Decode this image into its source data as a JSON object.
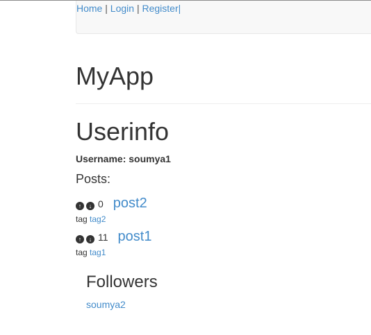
{
  "nav": {
    "home": "Home",
    "sep1": "|",
    "login": "Login",
    "sep2": "|",
    "register": "Register|"
  },
  "brand": "MyApp",
  "page_title": "Userinfo",
  "username_line": "Username: soumya1",
  "posts_heading": "Posts:",
  "posts": [
    {
      "score": "0",
      "title": "post2",
      "tag_label": "tag",
      "tag": "tag2"
    },
    {
      "score": "11",
      "title": "post1",
      "tag_label": "tag",
      "tag": "tag1"
    }
  ],
  "followers": {
    "heading": "Followers",
    "items": [
      "soumya2"
    ]
  },
  "icons": {
    "upvote": "circle-arrow-up-icon",
    "downvote": "circle-arrow-down-icon"
  },
  "colors": {
    "link": "#428bca",
    "text": "#333333",
    "navbar_bg": "#f8f8f8"
  }
}
